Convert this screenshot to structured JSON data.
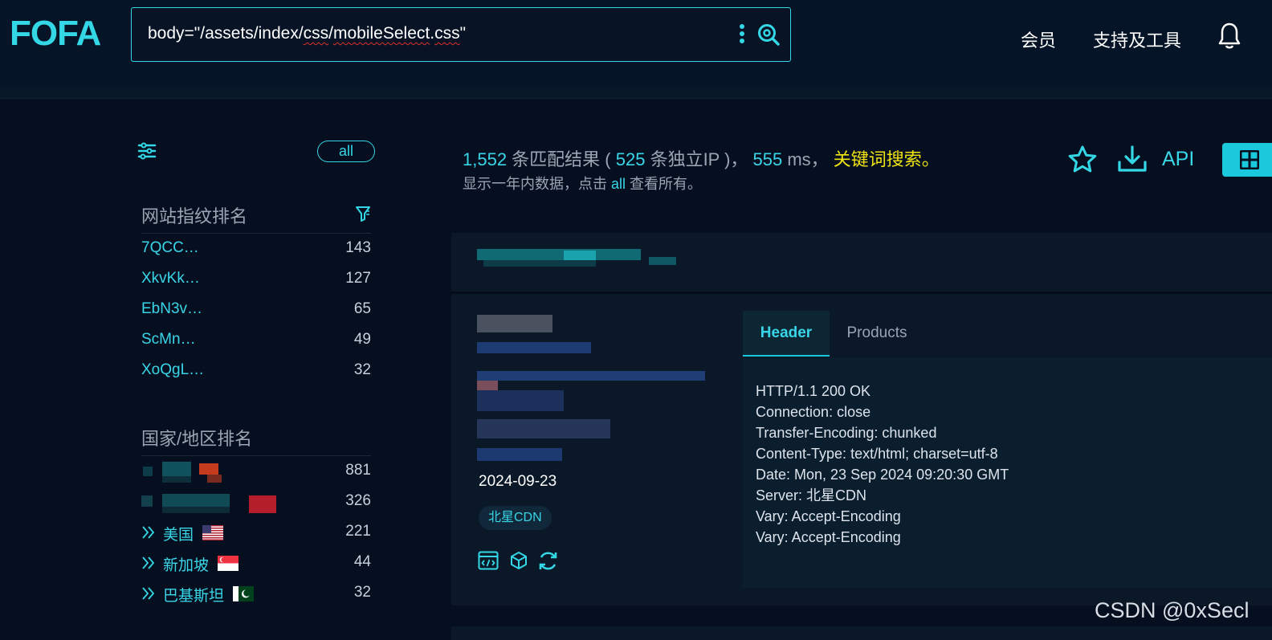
{
  "header": {
    "logo_text": "FOFA",
    "search": {
      "query_prefix": "body=\"/assets/index/",
      "query_css1": "css",
      "query_mid": "/",
      "query_word": "mobileSelect",
      "query_dot": ".",
      "query_css2": "css",
      "query_suffix": "\""
    },
    "nav": {
      "member": "会员",
      "tools": "支持及工具"
    }
  },
  "sidebar": {
    "all_label": "all",
    "fingerprint": {
      "title": "网站指纹排名",
      "items": [
        {
          "name": "7QCC…",
          "count": "143"
        },
        {
          "name": "XkvKk…",
          "count": "127"
        },
        {
          "name": "EbN3v…",
          "count": "65"
        },
        {
          "name": "ScMn…",
          "count": "49"
        },
        {
          "name": "XoQgL…",
          "count": "32"
        }
      ]
    },
    "countries": {
      "title": "国家/地区排名",
      "items": [
        {
          "name": "",
          "count": "881"
        },
        {
          "name": "",
          "count": "326"
        },
        {
          "name": "美国",
          "count": "221"
        },
        {
          "name": "新加坡",
          "count": "44"
        },
        {
          "name": "巴基斯坦",
          "count": "32"
        }
      ]
    }
  },
  "stats": {
    "total": "1,552",
    "total_label": " 条匹配结果 ( ",
    "unique_ip": "525",
    "unique_ip_label": " 条独立IP )， ",
    "time": "555",
    "time_label": " ms， ",
    "keyword_link": "关键词搜索",
    "end": "。",
    "sub_prefix": "显示一年内数据，点击 ",
    "sub_all": "all",
    "sub_suffix": " 查看所有。",
    "api_label": "API"
  },
  "result": {
    "date": "2024-09-23",
    "tag": "北星CDN",
    "tabs": {
      "header": "Header",
      "products": "Products"
    },
    "header_lines": [
      "HTTP/1.1 200 OK",
      "Connection: close",
      "Transfer-Encoding: chunked",
      "Content-Type: text/html; charset=utf-8",
      "Date: Mon, 23 Sep 2024 09:20:30 GMT",
      "Server: 北星CDN",
      "Vary: Accept-Encoding",
      "Vary: Accept-Encoding"
    ]
  },
  "watermark": "CSDN @0xSecl",
  "colors": {
    "accent": "#39d6e8",
    "highlight": "#f1e313",
    "background": "#060f1f"
  }
}
